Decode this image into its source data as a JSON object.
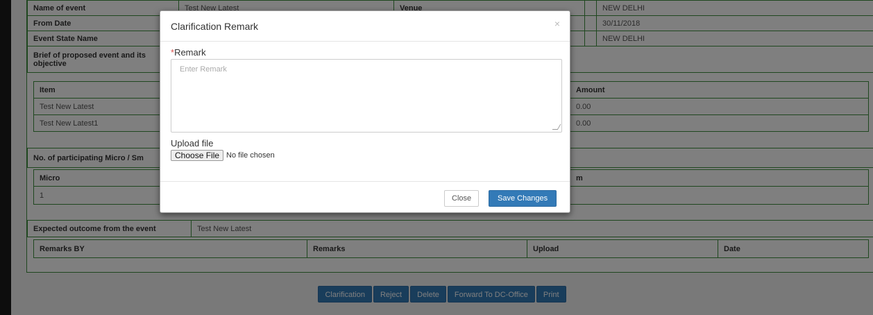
{
  "event_info": {
    "row1": {
      "label": "Name of event",
      "value": "Test New Latest",
      "label2": "Venue",
      "value2": "NEW DELHI"
    },
    "row2": {
      "label": "From Date",
      "value": "30/11/2018"
    },
    "row3": {
      "label": "Event State Name",
      "value": "NEW DELHI"
    },
    "brief_label": "Brief of proposed event and its objective"
  },
  "items_table": {
    "headers": [
      "Item",
      "Amount"
    ],
    "rows": [
      {
        "item": "Test New Latest",
        "amount": "0.00"
      },
      {
        "item": "Test New Latest1",
        "amount": "0.00"
      }
    ]
  },
  "participation": {
    "label": "No. of participating Micro / Sm",
    "headers": [
      "Micro",
      "m"
    ],
    "rows": [
      {
        "micro": "1"
      }
    ]
  },
  "outcome": {
    "label": "Expected outcome from the event",
    "value": "Test New Latest"
  },
  "remarks_table": {
    "headers": [
      "Remarks BY",
      "Remarks",
      "Upload",
      "Date"
    ]
  },
  "actions": {
    "clarification": "Clarification",
    "reject": "Reject",
    "delete": "Delete",
    "forward": "Forward To DC-Office",
    "print": "Print"
  },
  "modal": {
    "title": "Clarification Remark",
    "close_glyph": "×",
    "remark_required": "*",
    "remark_label": "Remark",
    "remark_placeholder": "Enter Remark",
    "upload_label": "Upload file",
    "choose_file": "Choose File",
    "no_file": "No file chosen",
    "close_button": "Close",
    "save_button": "Save Changes"
  },
  "colors": {
    "primary": "#337ab7",
    "border_green": "#3f8f3f",
    "overlay": "rgba(0,0,0,0.5)"
  }
}
